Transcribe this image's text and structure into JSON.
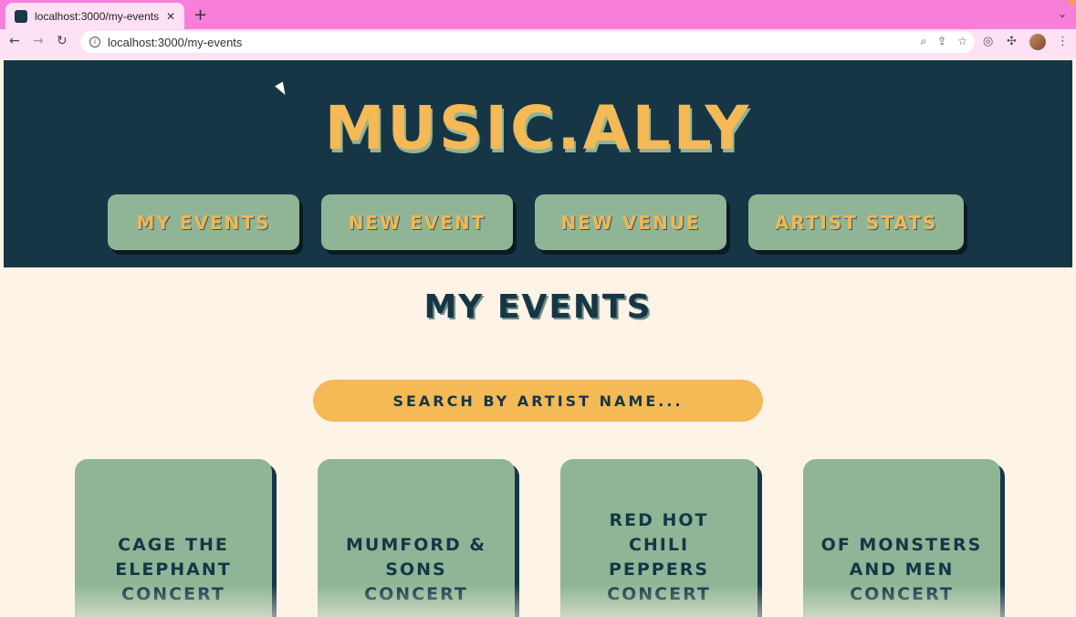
{
  "browser": {
    "tab_title": "localhost:3000/my-events",
    "tab_close": "✕",
    "new_tab": "+",
    "url": "localhost:3000/my-events"
  },
  "app": {
    "logo": "MUSIC.ALLY",
    "nav": [
      {
        "label": "MY EVENTS"
      },
      {
        "label": "NEW EVENT"
      },
      {
        "label": "NEW VENUE"
      },
      {
        "label": "ARTIST STATS"
      }
    ],
    "page_title": "MY EVENTS",
    "search": {
      "placeholder": "SEARCH BY ARTIST NAME..."
    },
    "events": [
      {
        "title": "CAGE THE ELEPHANT CONCERT"
      },
      {
        "title": "MUMFORD & SONS CONCERT"
      },
      {
        "title": "RED HOT CHILI PEPPERS CONCERT"
      },
      {
        "title": "OF MONSTERS AND MEN CONCERT"
      }
    ]
  },
  "colors": {
    "header_bg": "#163646",
    "accent_yellow": "#f5b955",
    "sage_green": "#8fb596",
    "page_bg": "#fdf3e7",
    "chrome_pink": "#f77fd9"
  },
  "icons": [
    "back-icon",
    "forward-icon",
    "reload-icon",
    "info-icon",
    "zoom-icon",
    "share-icon",
    "star-icon",
    "extension-icon",
    "puzzle-icon",
    "menu-icon"
  ]
}
